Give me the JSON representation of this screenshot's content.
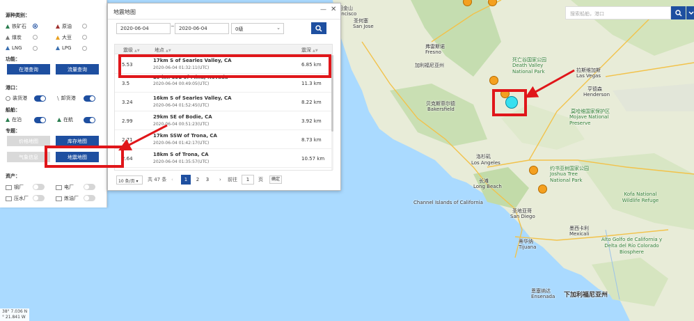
{
  "left_panel": {
    "fuel_type_title": "源种类别：",
    "fuel_types": [
      {
        "label": "铁矿石",
        "icon": "ship-green-icon",
        "selected": true
      },
      {
        "label": "原油",
        "icon": "ship-red-icon",
        "selected": false
      },
      {
        "label": "煤炭",
        "icon": "ship-grey-icon",
        "selected": false
      },
      {
        "label": "大豆",
        "icon": "ship-yellow-icon",
        "selected": false
      },
      {
        "label": "LNG",
        "icon": "ship-blue-icon",
        "selected": false
      },
      {
        "label": "LPG",
        "icon": "ship-blue-icon",
        "selected": false
      }
    ],
    "function_title": "功能：",
    "func_buttons": [
      "在港查询",
      "流量查询"
    ],
    "port_title": "港口：",
    "port_toggles": [
      {
        "label": "装货港",
        "on": true
      },
      {
        "label": "卸货港",
        "on": true
      }
    ],
    "ship_title": "船舶：",
    "ship_toggles": [
      {
        "label": "在泊",
        "on": true
      },
      {
        "label": "在航",
        "on": true
      }
    ],
    "topic_title": "专题：",
    "topic_buttons": [
      {
        "label": "价格地图",
        "active": false
      },
      {
        "label": "库存地图",
        "active": true
      },
      {
        "label": "气象信息",
        "active": false
      },
      {
        "label": "地震地图",
        "active": true
      }
    ],
    "asset_title": "资产：",
    "assets": [
      {
        "label": "钢厂",
        "on": false
      },
      {
        "label": "电厂",
        "on": false
      },
      {
        "label": "压水厂",
        "on": false
      },
      {
        "label": "炼油厂",
        "on": false
      }
    ]
  },
  "dialog": {
    "title": "地震地图",
    "date_from": "2020-06-04",
    "date_to": "2020-06-04",
    "tilde": "~",
    "level_value": "0级",
    "columns": [
      "震级",
      "地点",
      "震深"
    ],
    "rows": [
      {
        "level": "5.53",
        "place": "17km S of Searles Valley, CA",
        "time": "2020-06-04 01:32:11(UTC)",
        "depth": "6.85 km"
      },
      {
        "level": "3.5",
        "place": "29 km SSE of Mina, Nevada",
        "time": "2020-06-04 00:49:05(UTC)",
        "depth": "11.3 km"
      },
      {
        "level": "3.24",
        "place": "16km S of Searles Valley, CA",
        "time": "2020-06-04 01:52:45(UTC)",
        "depth": "8.22 km"
      },
      {
        "level": "2.99",
        "place": "29km SE of Bodie, CA",
        "time": "2020-06-04 00:51:23(UTC)",
        "depth": "3.92 km"
      },
      {
        "level": "2.71",
        "place": "17km SSW of Trona, CA",
        "time": "2020-06-04 01:42:17(UTC)",
        "depth": "8.73 km"
      },
      {
        "level": "2.64",
        "place": "18km S of Trona, CA",
        "time": "2020-06-04 01:35:57(UTC)",
        "depth": "10.57 km"
      }
    ],
    "pager": {
      "page_size": "10 条/页",
      "total": "共 47 条",
      "pages": [
        "1",
        "2",
        "3"
      ],
      "goto_label": "前往",
      "goto_value": "1",
      "page_unit": "页",
      "confirm": "确定"
    }
  },
  "map": {
    "search_placeholder": "搜索船舶，港口",
    "coord_lat": "38° 7.036 N",
    "coord_lon": "° 21.841 W",
    "labels": [
      {
        "text": "旧金山",
        "cls": ""
      },
      {
        "text": "ancisco",
        "cls": ""
      },
      {
        "text": "圣何塞",
        "cls": ""
      },
      {
        "text": "San Jose",
        "cls": ""
      },
      {
        "text": "弗雷斯诺",
        "cls": ""
      },
      {
        "text": "Fresno",
        "cls": ""
      },
      {
        "text": "加利福尼亚州",
        "cls": "big"
      },
      {
        "text": "贝克斯菲尔德",
        "cls": ""
      },
      {
        "text": "Bakersfield",
        "cls": ""
      },
      {
        "text": "洛杉矶",
        "cls": ""
      },
      {
        "text": "Los Angeles",
        "cls": "big"
      },
      {
        "text": "长滩",
        "cls": ""
      },
      {
        "text": "Long Beach",
        "cls": ""
      },
      {
        "text": "圣地亚哥",
        "cls": ""
      },
      {
        "text": "San Diego",
        "cls": ""
      },
      {
        "text": "蒂华纳",
        "cls": ""
      },
      {
        "text": "Tijuana",
        "cls": ""
      },
      {
        "text": "墨西卡利",
        "cls": ""
      },
      {
        "text": "Mexicali",
        "cls": ""
      },
      {
        "text": "恩塞纳达",
        "cls": ""
      },
      {
        "text": "Ensenada",
        "cls": ""
      },
      {
        "text": "拉斯维加斯",
        "cls": ""
      },
      {
        "text": "Las Vegas",
        "cls": "big"
      },
      {
        "text": "亨德森",
        "cls": ""
      },
      {
        "text": "Henderson",
        "cls": ""
      },
      {
        "text": "莫哈维国家保护区",
        "cls": "green"
      },
      {
        "text": "Mojave National Preserve",
        "cls": "green"
      },
      {
        "text": "死亡谷国家公园",
        "cls": "green"
      },
      {
        "text": "Death Valley National Park",
        "cls": "green"
      },
      {
        "text": "约书亚树国家公园",
        "cls": "green"
      },
      {
        "text": "Joshua Tree National Park",
        "cls": "green"
      },
      {
        "text": "下加利福尼亚州",
        "cls": "big"
      },
      {
        "text": "Channel Islands of California",
        "cls": ""
      },
      {
        "text": "Kofa National Wildlife Refuge",
        "cls": "green"
      },
      {
        "text": "Alto Golfo de California y Delta del Río Colorado Biosphere",
        "cls": "green"
      }
    ]
  }
}
